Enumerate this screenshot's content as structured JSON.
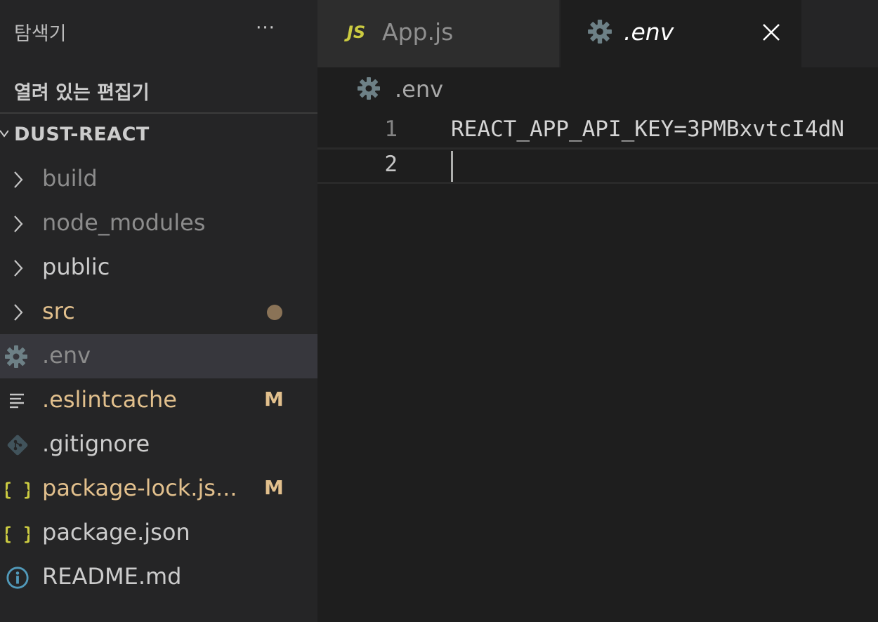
{
  "sidebar": {
    "title": "탐색기",
    "more_label": "···",
    "open_editors_label": "열려 있는 편집기",
    "project_label": "DUST-REACT",
    "items": [
      {
        "label": "build",
        "kind": "folder",
        "icon": "chevron-right-icon"
      },
      {
        "label": "node_modules",
        "kind": "folder",
        "icon": "chevron-right-icon"
      },
      {
        "label": "public",
        "kind": "folder",
        "icon": "chevron-right-icon"
      },
      {
        "label": "src",
        "kind": "folder",
        "icon": "chevron-right-icon",
        "modified_dot": true
      },
      {
        "label": ".env",
        "kind": "file",
        "icon": "gear-icon",
        "selected": true
      },
      {
        "label": ".eslintcache",
        "kind": "file",
        "icon": "lines-icon",
        "badge": "M"
      },
      {
        "label": ".gitignore",
        "kind": "file",
        "icon": "git-icon"
      },
      {
        "label": "package-lock.js...",
        "kind": "file",
        "icon": "braces-icon",
        "badge": "M"
      },
      {
        "label": "package.json",
        "kind": "file",
        "icon": "braces-icon"
      },
      {
        "label": "README.md",
        "kind": "file",
        "icon": "info-icon"
      }
    ]
  },
  "tabs": [
    {
      "badge": "JS",
      "label": "App.js",
      "active": false
    },
    {
      "label": ".env",
      "active": true
    }
  ],
  "breadcrumb": {
    "label": ".env"
  },
  "editor": {
    "lines": [
      {
        "number": "1",
        "text": "REACT_APP_API_KEY=3PMBxvtcI4dN"
      },
      {
        "number": "2",
        "text": ""
      }
    ]
  },
  "colors": {
    "modified": "#e2c08d",
    "selection": "#37373d",
    "js_badge": "#cbcb41",
    "braces": "#cbcb41",
    "gear": "#6d8086",
    "info": "#519aba",
    "git": "#41535b"
  }
}
